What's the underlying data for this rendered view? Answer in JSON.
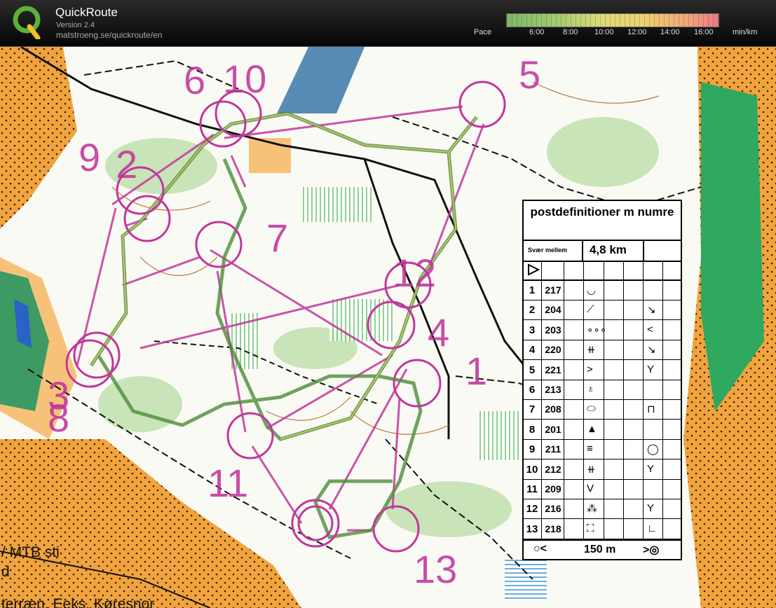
{
  "app": {
    "title": "QuickRoute",
    "version": "Version 2.4",
    "url": "matstroeng.se/quickroute/en"
  },
  "pace_scale": {
    "label": "Pace",
    "ticks": [
      "6:00",
      "8:00",
      "10:00",
      "12:00",
      "14:00",
      "16:00"
    ],
    "unit": "min/km",
    "colors": [
      "#7cb86a",
      "#dcdc78",
      "#f0a878",
      "#f07888"
    ]
  },
  "controls": [
    "1",
    "2",
    "3",
    "4",
    "5",
    "6",
    "7",
    "8",
    "9",
    "10",
    "11",
    "12",
    "13"
  ],
  "map_legend_text": [
    "/ MTB sti",
    "d",
    "terræn. Eeks. Køresnor"
  ],
  "description_sheet": {
    "title": "postdefinitioner m numre",
    "class": "Svær mellem",
    "length": "4,8 km",
    "rows": [
      {
        "num": "1",
        "code": "217",
        "sym": "◡",
        "extra": ""
      },
      {
        "num": "2",
        "code": "204",
        "sym": "⟋",
        "extra": "↘"
      },
      {
        "num": "3",
        "code": "203",
        "sym": "∘∘∘",
        "extra": "<"
      },
      {
        "num": "4",
        "code": "220",
        "sym": "⧺",
        "extra": "↘"
      },
      {
        "num": "5",
        "code": "221",
        "sym": ">",
        "extra": "Y"
      },
      {
        "num": "6",
        "code": "213",
        "sym": "♁",
        "extra": ""
      },
      {
        "num": "7",
        "code": "208",
        "sym": "⬭",
        "extra": "⊓"
      },
      {
        "num": "8",
        "code": "201",
        "sym": "▲",
        "extra": ""
      },
      {
        "num": "9",
        "code": "211",
        "sym": "≡",
        "extra": "◯"
      },
      {
        "num": "10",
        "code": "212",
        "sym": "⧺",
        "extra": "Y"
      },
      {
        "num": "11",
        "code": "209",
        "sym": "V",
        "extra": ""
      },
      {
        "num": "12",
        "code": "216",
        "sym": "⁂",
        "extra": "Y"
      },
      {
        "num": "13",
        "code": "218",
        "sym": "⛶",
        "extra": "∟"
      }
    ],
    "footer": "150 m"
  }
}
